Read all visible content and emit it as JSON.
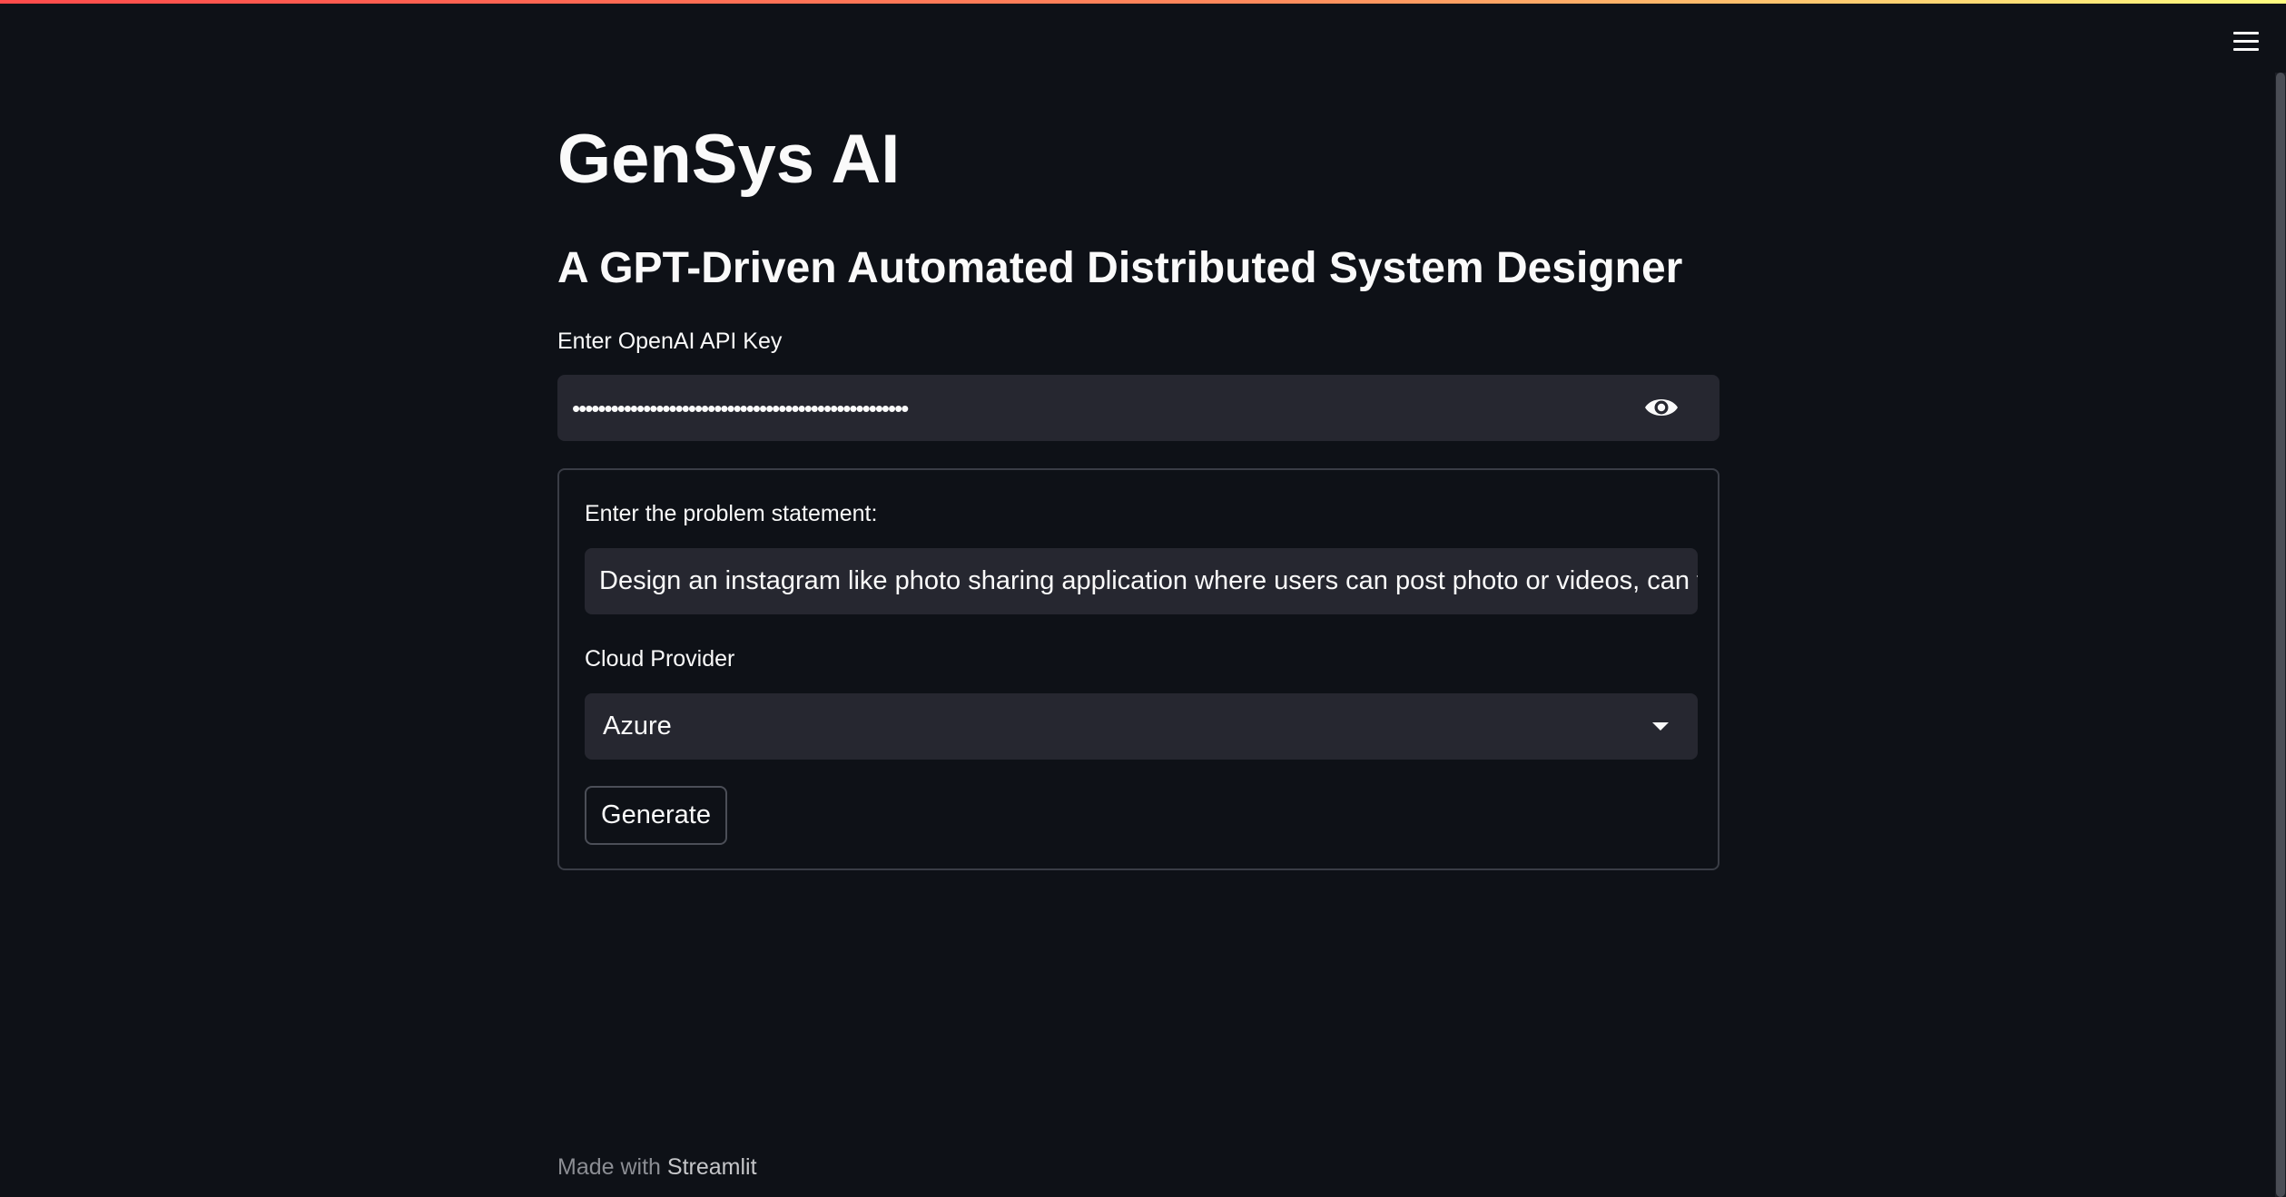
{
  "app": {
    "title": "GenSys AI",
    "subtitle": "A GPT-Driven Automated Distributed System Designer"
  },
  "api_key": {
    "label": "Enter OpenAI API Key",
    "masked_value": "••••••••••••••••••••••••••••••••••••••••••••••••••••"
  },
  "form": {
    "problem_label": "Enter the problem statement:",
    "problem_value": "Design an instagram like photo sharing application where users can post photo or videos, can follow",
    "cloud_label": "Cloud Provider",
    "cloud_selected": "Azure",
    "generate_label": "Generate"
  },
  "footer": {
    "prefix": "Made with ",
    "link": "Streamlit"
  },
  "icons": {
    "menu": "hamburger-menu-icon",
    "visibility": "eye-icon",
    "dropdown": "chevron-down-icon"
  },
  "colors": {
    "background": "#0e1117",
    "input_background": "#262730",
    "accent_gradient_start": "#ff4b4b",
    "accent_gradient_end": "#fffd80"
  }
}
